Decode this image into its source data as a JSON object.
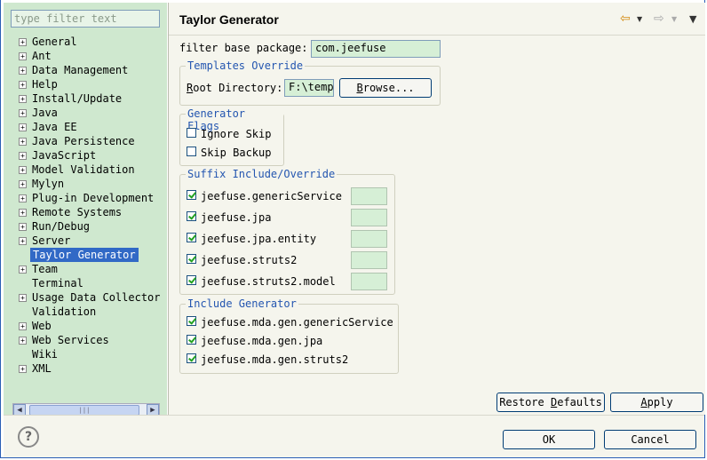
{
  "filter": {
    "placeholder": "type filter text"
  },
  "tree": [
    {
      "label": "General",
      "expandable": true
    },
    {
      "label": "Ant",
      "expandable": true
    },
    {
      "label": "Data Management",
      "expandable": true
    },
    {
      "label": "Help",
      "expandable": true
    },
    {
      "label": "Install/Update",
      "expandable": true
    },
    {
      "label": "Java",
      "expandable": true
    },
    {
      "label": "Java EE",
      "expandable": true
    },
    {
      "label": "Java Persistence",
      "expandable": true
    },
    {
      "label": "JavaScript",
      "expandable": true
    },
    {
      "label": "Model Validation",
      "expandable": true
    },
    {
      "label": "Mylyn",
      "expandable": true
    },
    {
      "label": "Plug-in Development",
      "expandable": true
    },
    {
      "label": "Remote Systems",
      "expandable": true
    },
    {
      "label": "Run/Debug",
      "expandable": true
    },
    {
      "label": "Server",
      "expandable": true
    },
    {
      "label": "Taylor Generator",
      "expandable": false,
      "selected": true
    },
    {
      "label": "Team",
      "expandable": true
    },
    {
      "label": "Terminal",
      "expandable": false
    },
    {
      "label": "Usage Data Collector",
      "expandable": true
    },
    {
      "label": "Validation",
      "expandable": false
    },
    {
      "label": "Web",
      "expandable": true
    },
    {
      "label": "Web Services",
      "expandable": true
    },
    {
      "label": "Wiki",
      "expandable": false
    },
    {
      "label": "XML",
      "expandable": true
    }
  ],
  "page": {
    "title": "Taylor Generator",
    "base_package_label": "filter base package:",
    "base_package_value": "com.jeefuse"
  },
  "templates": {
    "legend": "Templates Override",
    "root_label": "Root Directory:",
    "root_value": "F:\\temp",
    "browse_label": "Browse..."
  },
  "flags": {
    "legend": "Generator Flags",
    "items": [
      {
        "label": "Ignore Skip",
        "checked": false
      },
      {
        "label": "Skip Backup",
        "checked": false
      }
    ]
  },
  "suffix": {
    "legend": "Suffix Include/Override",
    "items": [
      {
        "label": "jeefuse.genericService",
        "checked": true
      },
      {
        "label": "jeefuse.jpa",
        "checked": true
      },
      {
        "label": "jeefuse.jpa.entity",
        "checked": true
      },
      {
        "label": "jeefuse.struts2",
        "checked": true
      },
      {
        "label": "jeefuse.struts2.model",
        "checked": true
      }
    ]
  },
  "include": {
    "legend": "Include Generator",
    "items": [
      {
        "label": "jeefuse.mda.gen.genericService",
        "checked": true
      },
      {
        "label": "jeefuse.mda.gen.jpa",
        "checked": true
      },
      {
        "label": "jeefuse.mda.gen.struts2",
        "checked": true
      }
    ]
  },
  "actions": {
    "restore_label": "Restore Defaults",
    "apply_label": "Apply",
    "ok_label": "OK",
    "cancel_label": "Cancel"
  },
  "icons": {
    "back": "back-arrow-icon",
    "forward": "forward-arrow-icon",
    "menu": "view-menu-icon",
    "help": "help-icon"
  },
  "colors": {
    "selection": "#3169c6",
    "legend": "#2456b0",
    "left_panel": "#cfe8cf",
    "check": "#21a121"
  }
}
